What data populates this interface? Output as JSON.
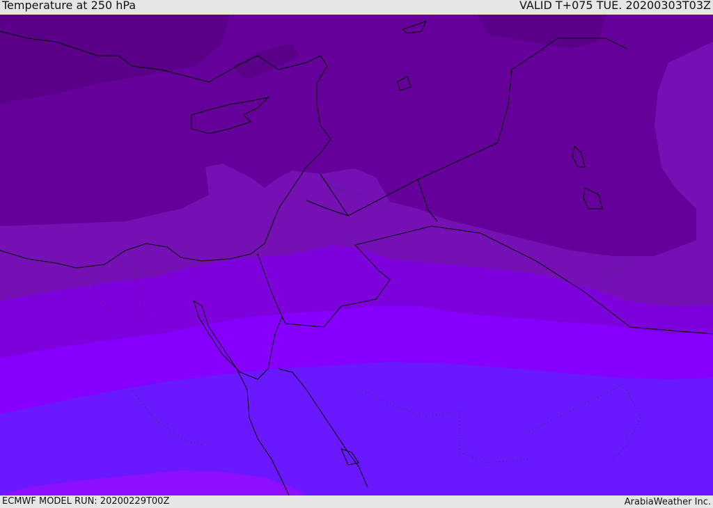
{
  "header": {
    "title": "Temperature at 250 hPa",
    "valid_time": "VALID T+075 TUE. 20200303T03Z"
  },
  "footer": {
    "model_run": "ECMWF MODEL RUN: 20200229T00Z",
    "credit": "ArabiaWeather Inc."
  },
  "map": {
    "field": "temperature",
    "level": "250 hPa",
    "colors": {
      "coldest": "#5a0088",
      "cold": "#66009a",
      "mid": "#7610b8",
      "warmish": "#8000e0",
      "warm": "#8500ff",
      "warmest": "#6a18ff",
      "pink_band": "#8c10ff"
    }
  }
}
